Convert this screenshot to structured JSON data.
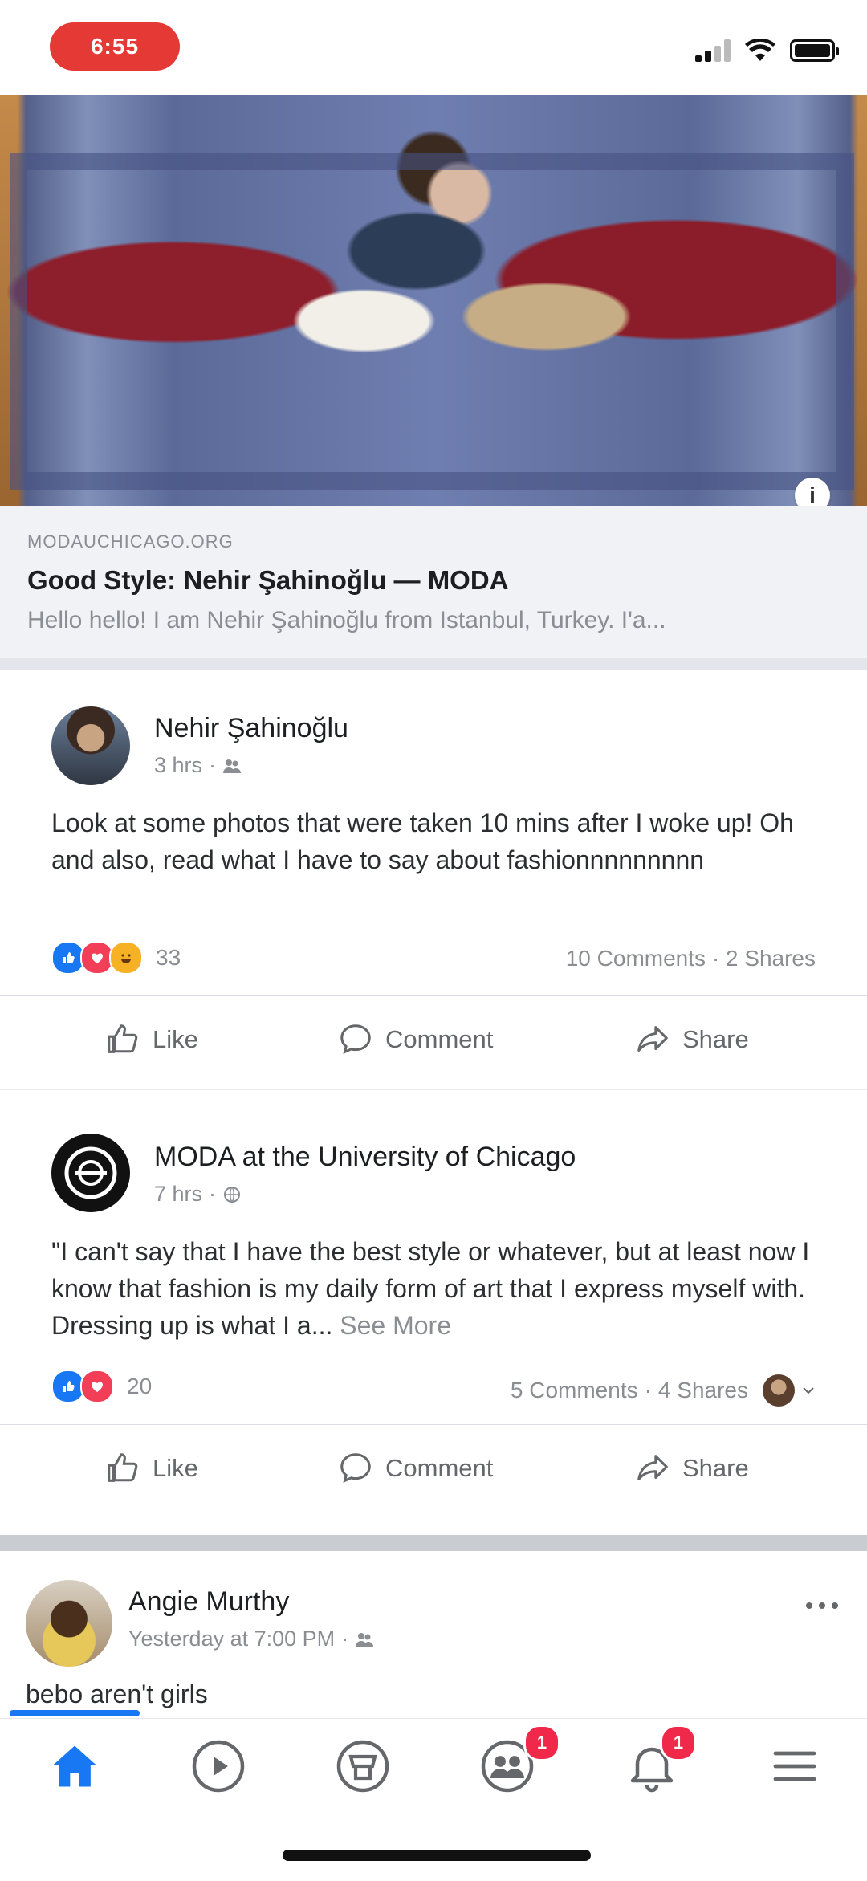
{
  "status_bar": {
    "time": "6:55"
  },
  "shared_link": {
    "source": "MODAUCHICAGO.ORG",
    "title": "Good Style: Nehir Şahinoğlu — MODA",
    "description": "Hello hello! I am Nehir Şahinoğlu from Istanbul, Turkey. I'a...",
    "more_label": "i"
  },
  "post1": {
    "author": "Nehir Şahinoğlu",
    "time": "3 hrs",
    "text": "Look at some photos that were taken 10 mins after I woke up! Oh and also, read what I have to say about fashionnnnnnnnn",
    "reactions_count": "33",
    "comments": "10 Comments",
    "shares": "2 Shares",
    "actions": {
      "like": "Like",
      "comment": "Comment",
      "share": "Share"
    }
  },
  "post2": {
    "author": "MODA at the University of Chicago",
    "time": "7 hrs",
    "text": "\"I can't say that I have the best style or whatever, but at least now I know that fashion is my daily form of art that I express myself with. Dressing up is what I a...",
    "see_more": "See More",
    "reactions_count": "20",
    "comments": "5 Comments",
    "shares": "4 Shares",
    "actions": {
      "like": "Like",
      "comment": "Comment",
      "share": "Share"
    }
  },
  "post3": {
    "author": "Angie Murthy",
    "time": "Yesterday at 7:00 PM",
    "text": "bebo aren't girls"
  },
  "tabs": {
    "home_badge": "",
    "groups_badge": "1",
    "notifications_badge": "1"
  },
  "colors": {
    "accent": "#1877f2",
    "badge": "#f02849",
    "rec": "#e53935"
  }
}
